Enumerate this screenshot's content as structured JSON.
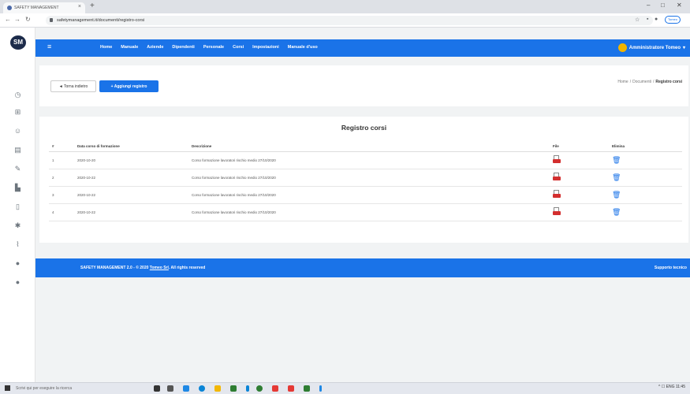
{
  "browser": {
    "tab_title": "SAFETY MANAGEMENT",
    "tab_close": "×",
    "new_tab": "+",
    "url": "safetymanagement.it/documenti/registro-corsi",
    "profile": "Tomeo",
    "window_controls": [
      "–",
      "□",
      "✕"
    ]
  },
  "app": {
    "logo_text": "SM",
    "menu": [
      "Home",
      "Manuale",
      "Aziende",
      "Dipendenti",
      "Personale",
      "Corsi",
      "Impostazioni",
      "Manuale d'uso"
    ],
    "user_name": "Amministratore Tomeo"
  },
  "toolbar": {
    "back_label": "◄ Torna indietro",
    "add_label": "+ Aggiungi registro"
  },
  "breadcrumb": {
    "home": "Home",
    "sep": "/",
    "section": "Documenti",
    "current": "Registro corsi"
  },
  "page": {
    "title": "Registro corsi"
  },
  "table": {
    "headers": [
      "#",
      "Data corso di formazione",
      "Descrizione",
      "File",
      "Elimina"
    ],
    "rows": [
      {
        "num": "1",
        "date": "2020-10-20",
        "desc": "Corso formazione lavoratori rischio medio 27/10/2020"
      },
      {
        "num": "2",
        "date": "2020-10-22",
        "desc": "Corso formazione lavoratori rischio medio 27/10/2020"
      },
      {
        "num": "3",
        "date": "2020-10-22",
        "desc": "Corso formazione lavoratori rischio medio 27/10/2020"
      },
      {
        "num": "4",
        "date": "2020-10-22",
        "desc": "Corso formazione lavoratori rischio medio 27/10/2020"
      }
    ]
  },
  "footer": {
    "left_text": "SAFETY MANAGEMENT 2.0 - © 2020",
    "left_link": "Tomeo Srl",
    "left_suffix": ". All rights reserved",
    "right_text": "Supporto tecnico"
  },
  "taskbar": {
    "search_placeholder": "Scrivi qui per eseguire la ricerca",
    "tray": "^  ☐ ENG  11:45"
  },
  "colors": {
    "primary": "#1a73e8",
    "pdf_red": "#d32f2f"
  }
}
